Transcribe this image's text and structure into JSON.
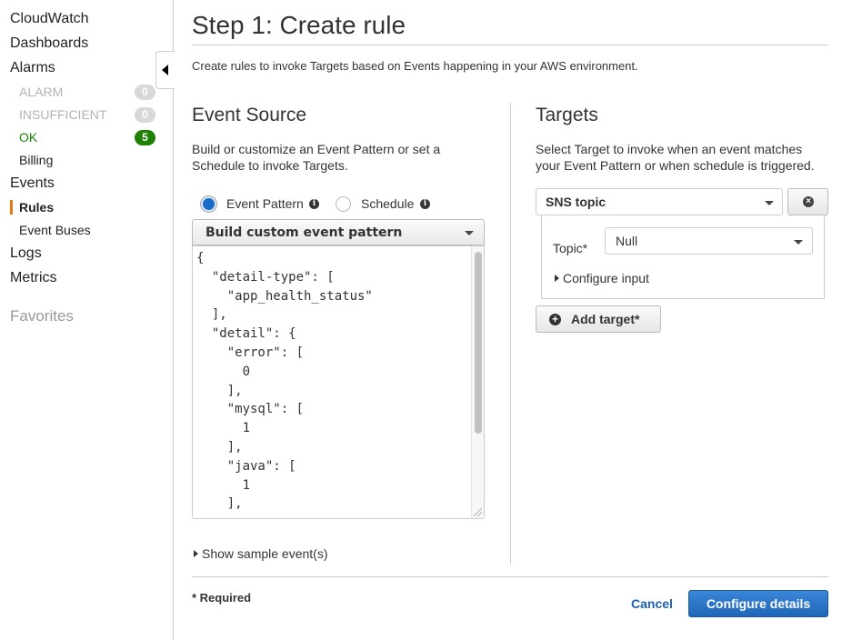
{
  "sidebar": {
    "items": [
      {
        "label": "CloudWatch"
      },
      {
        "label": "Dashboards"
      },
      {
        "label": "Alarms"
      },
      {
        "label": "ALARM",
        "count": "0"
      },
      {
        "label": "INSUFFICIENT",
        "count": "0"
      },
      {
        "label": "OK",
        "count": "5"
      },
      {
        "label": "Billing"
      },
      {
        "label": "Events"
      },
      {
        "label": "Rules"
      },
      {
        "label": "Event Buses"
      },
      {
        "label": "Logs"
      },
      {
        "label": "Metrics"
      }
    ],
    "favorites_label": "Favorites",
    "active_item": "Rules",
    "accent_color": "#e07b17"
  },
  "page": {
    "title": "Step 1: Create rule",
    "intro": "Create rules to invoke Targets based on Events happening in your AWS environment."
  },
  "event_source": {
    "title": "Event Source",
    "description_line1": "Build or customize an Event Pattern or set a",
    "description_line2": "Schedule to invoke Targets.",
    "radio_options": [
      {
        "label": "Event Pattern",
        "selected": true
      },
      {
        "label": "Schedule",
        "selected": false
      }
    ],
    "pattern_select": "Build custom event pattern",
    "pattern_code": "{\n  \"detail-type\": [\n    \"app_health_status\"\n  ],\n  \"detail\": {\n    \"error\": [\n      0\n    ],\n    \"mysql\": [\n      1\n    ],\n    \"java\": [\n      1\n    ],",
    "show_sample": "Show sample event(s)"
  },
  "targets": {
    "title": "Targets",
    "description_line1": "Select Target to invoke when an event matches",
    "description_line2": "your Event Pattern or when schedule is triggered.",
    "target_type": "SNS topic",
    "topic_label": "Topic*",
    "topic_value": "Null",
    "configure_input": "Configure input",
    "add_target": "Add target*"
  },
  "footer": {
    "required_note": "* Required",
    "cancel": "Cancel",
    "primary": "Configure details",
    "primary_color": "#1f66b8"
  }
}
